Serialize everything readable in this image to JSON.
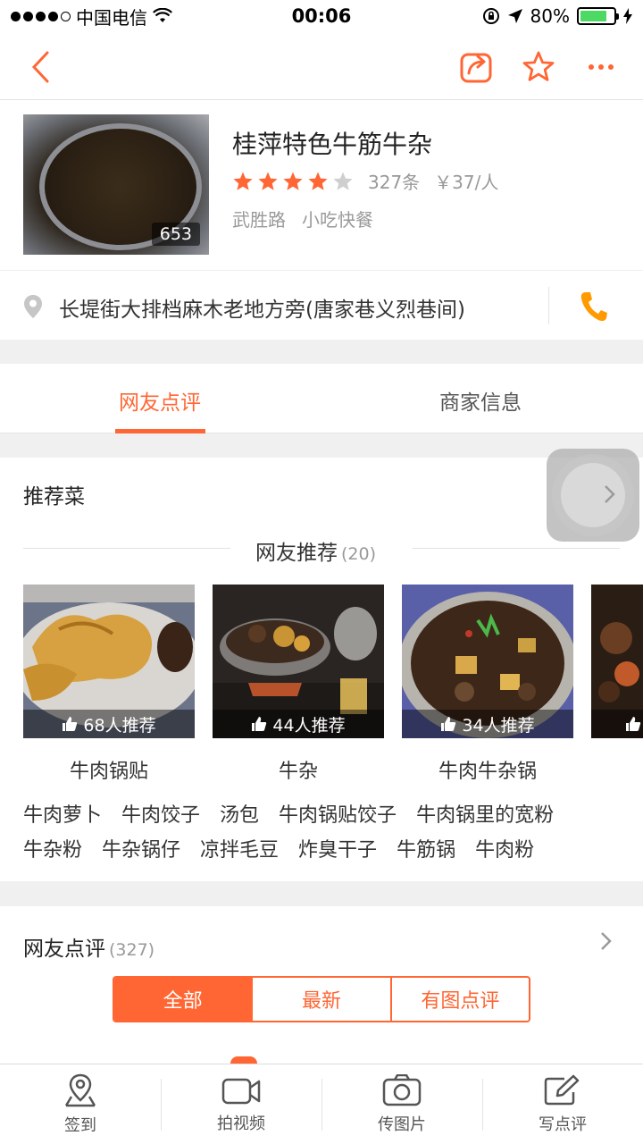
{
  "status_bar": {
    "carrier": "中国电信",
    "time": "00:06",
    "battery": "80%",
    "battery_level": 0.8
  },
  "nav": {
    "back_icon": "chevron-left-icon",
    "share_icon": "share-icon",
    "favorite_icon": "star-outline-icon",
    "more_icon": "more-dots-icon",
    "accent": "#ff6633"
  },
  "shop": {
    "name": "桂萍特色牛筋牛杂",
    "photo_count": "653",
    "rating": 4,
    "rating_max": 5,
    "review_count": "327条",
    "price": "￥37/人",
    "area": "武胜路",
    "category": "小吃快餐"
  },
  "address": {
    "text": "长堤街大排档麻木老地方旁(唐家巷义烈巷间)"
  },
  "tabs": [
    {
      "label": "网友点评",
      "active": true
    },
    {
      "label": "商家信息",
      "active": false
    }
  ],
  "recommend": {
    "title": "推荐菜",
    "sub_title": "网友推荐",
    "sub_count": "(20)",
    "dishes": [
      {
        "name": "牛肉锅贴",
        "badge": "68人推荐"
      },
      {
        "name": "牛杂",
        "badge": "44人推荐"
      },
      {
        "name": "牛肉牛杂锅",
        "badge": "34人推荐"
      }
    ],
    "more_row1": [
      "牛肉萝卜",
      "牛肉饺子",
      "汤包",
      "牛肉锅贴饺子",
      "牛肉锅里的宽粉"
    ],
    "more_row2": [
      "牛杂粉",
      "牛杂锅仔",
      "凉拌毛豆",
      "炸臭干子",
      "牛筋锅",
      "牛肉粉"
    ]
  },
  "reviews": {
    "title": "网友点评",
    "count": "(327)",
    "filters": [
      "全部",
      "最新",
      "有图点评"
    ]
  },
  "bottom_bar": [
    {
      "label": "签到",
      "icon": "location-pin-icon"
    },
    {
      "label": "拍视频",
      "icon": "video-camera-icon"
    },
    {
      "label": "传图片",
      "icon": "photo-upload-icon"
    },
    {
      "label": "写点评",
      "icon": "write-review-icon"
    }
  ]
}
